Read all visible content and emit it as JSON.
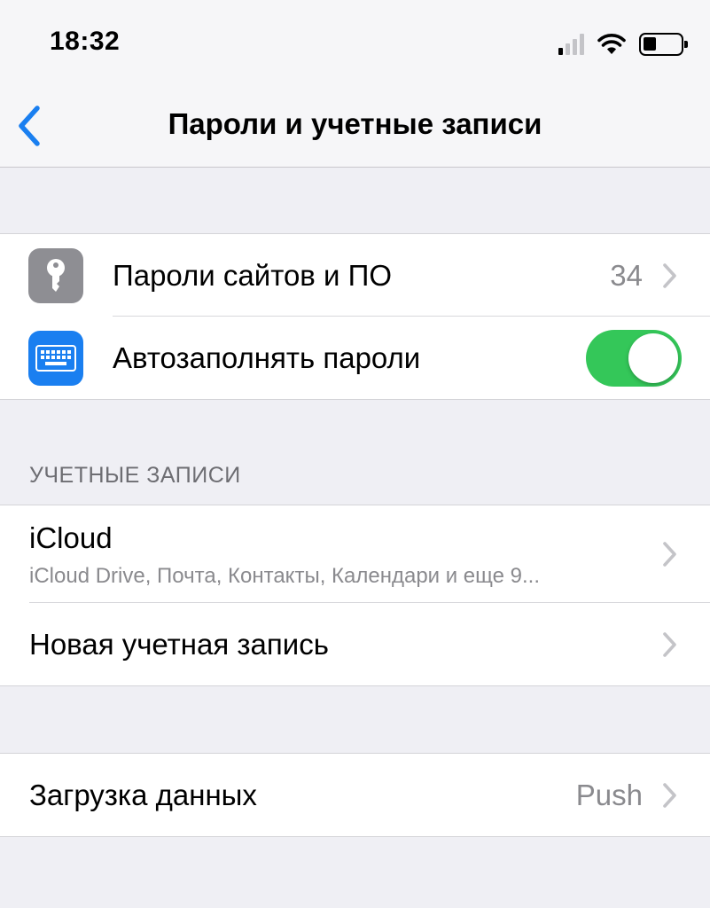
{
  "status_bar": {
    "time": "18:32",
    "signal_icon": "cellular-signal-icon",
    "wifi_icon": "wifi-icon",
    "battery_icon": "battery-icon"
  },
  "nav": {
    "back_icon": "chevron-left-icon",
    "title": "Пароли и учетные записи"
  },
  "passwords_group": {
    "items": [
      {
        "icon": "key-icon",
        "label": "Пароли сайтов и ПО",
        "value": "34"
      },
      {
        "icon": "keyboard-icon",
        "label": "Автозаполнять пароли",
        "toggle_on": true
      }
    ]
  },
  "accounts_section": {
    "header": "УЧЕТНЫЕ ЗАПИСИ",
    "items": [
      {
        "label": "iCloud",
        "subtitle": "iCloud Drive, Почта, Контакты, Календари и еще 9..."
      },
      {
        "label": "Новая учетная запись"
      }
    ]
  },
  "fetch_group": {
    "label": "Загрузка данных",
    "value": "Push"
  },
  "colors": {
    "accent": "#1a7ff0",
    "toggle_on": "#34c759",
    "key_icon_bg": "#8e8e93",
    "keyboard_icon_bg": "#1a7ff0"
  }
}
